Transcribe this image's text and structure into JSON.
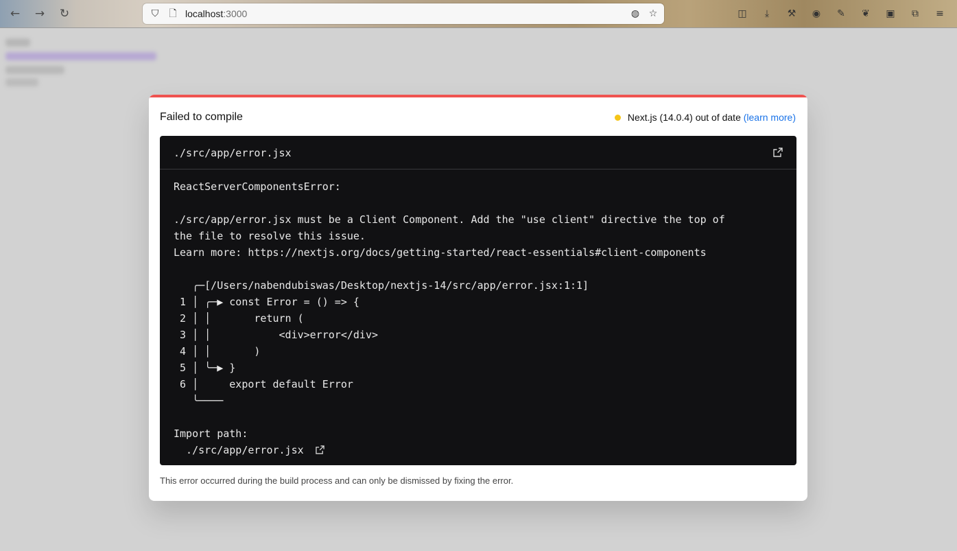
{
  "browser": {
    "url_host": "localhost",
    "url_port": ":3000"
  },
  "overlay": {
    "title": "Failed to compile",
    "version_text": "Next.js (14.0.4) out of date",
    "learn_more": "(learn more)",
    "file_path": "./src/app/error.jsx",
    "code_lines": [
      "ReactServerComponentsError:",
      "",
      "./src/app/error.jsx must be a Client Component. Add the \"use client\" directive the top of",
      "the file to resolve this issue.",
      "Learn more: https://nextjs.org/docs/getting-started/react-essentials#client-components",
      "",
      "   ╭─[/Users/nabendubiswas/Desktop/nextjs-14/src/app/error.jsx:1:1]",
      " 1 │ ╭─▶ const Error = () => {",
      " 2 │ │       return (",
      " 3 │ │           <div>error</div>",
      " 4 │ │       )",
      " 5 │ ╰─▶ }",
      " 6 │     export default Error",
      "   ╰────",
      "",
      "Import path:",
      "  ./src/app/error.jsx"
    ],
    "footer": "This error occurred during the build process and can only be dismissed by fixing the error."
  },
  "colors": {
    "overlay_accent": "#ef5350",
    "status_dot": "#f5c518",
    "link": "#1a73e8",
    "code_bg": "#111113"
  }
}
